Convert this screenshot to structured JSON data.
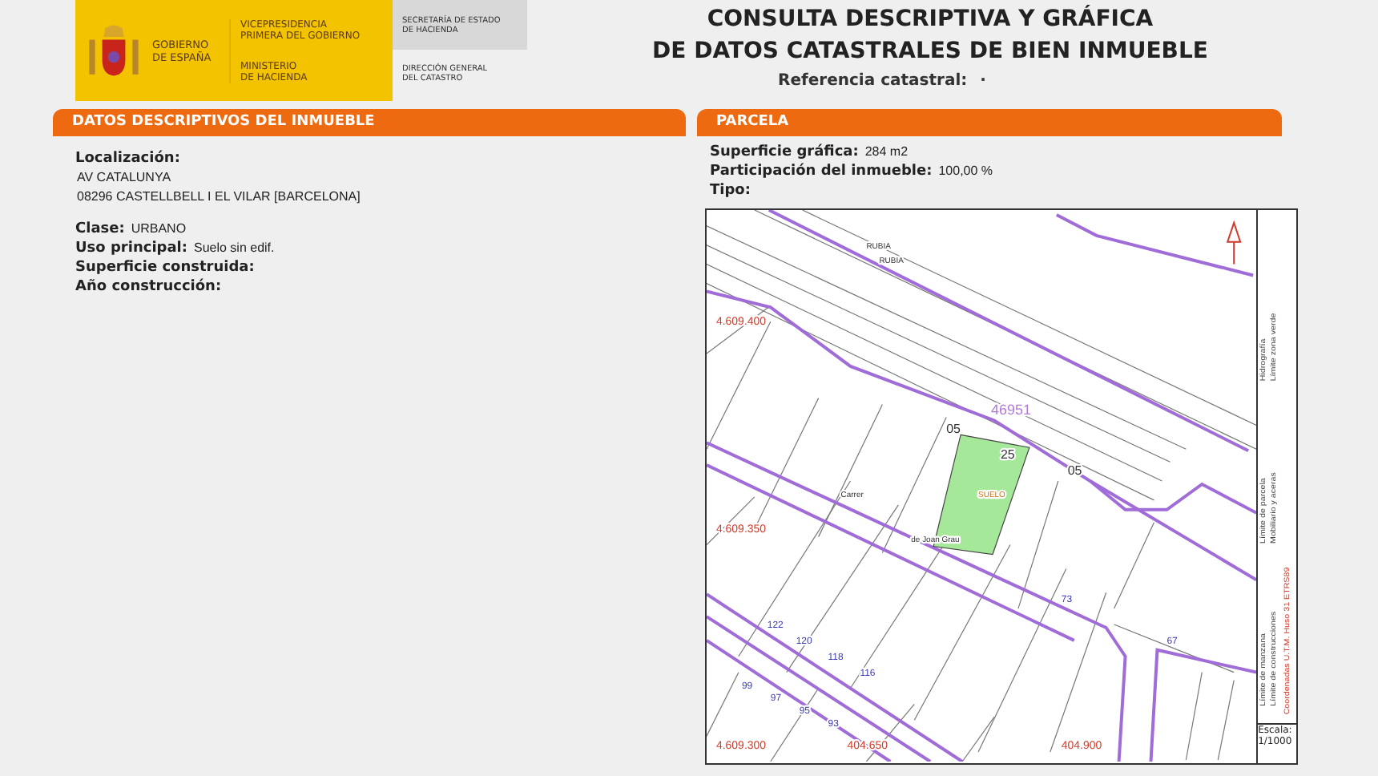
{
  "header": {
    "government": [
      "GOBIERNO",
      "DE ESPAÑA"
    ],
    "vicepresidency": [
      "VICEPRESIDENCIA",
      "PRIMERA DEL GOBIERNO"
    ],
    "ministry": [
      "MINISTERIO",
      "DE HACIENDA"
    ],
    "secretariat": [
      "SECRETARÍA DE ESTADO",
      "DE HACIENDA"
    ],
    "directorate": [
      "DIRECCIÓN GENERAL",
      "DEL CATASTRO"
    ]
  },
  "title": [
    "CONSULTA DESCRIPTIVA Y GRÁFICA",
    "DE DATOS CATASTRALES DE BIEN INMUEBLE"
  ],
  "reference": {
    "label": "Referencia catastral:",
    "value": "·"
  },
  "descriptive": {
    "heading": "DATOS DESCRIPTIVOS DEL INMUEBLE",
    "location_label": "Localización:",
    "address": [
      "AV CATALUNYA",
      "08296 CASTELLBELL I EL VILAR [BARCELONA]"
    ],
    "fields": [
      {
        "label": "Clase:",
        "value": "URBANO"
      },
      {
        "label": "Uso principal:",
        "value": "Suelo sin edif."
      },
      {
        "label": "Superficie construida:"
      },
      {
        "label": "Año construcción:"
      }
    ]
  },
  "parcel": {
    "heading": "PARCELA",
    "fields": [
      {
        "label": "Superficie gráfica:",
        "value": "284 m2"
      },
      {
        "label": "Participación del inmueble:",
        "value": "100,00 %"
      },
      {
        "label": "Tipo:"
      }
    ],
    "map": {
      "labels": [
        {
          "text": "RUBIA",
          "kind": "street"
        },
        {
          "text": "RUBIA",
          "kind": "street"
        },
        {
          "text": "4.609.400",
          "kind": "coordinate"
        },
        {
          "text": "4.609.350",
          "kind": "coordinate"
        },
        {
          "text": "4.609.300",
          "kind": "coordinate"
        },
        {
          "text": "404.650",
          "kind": "coordinate"
        },
        {
          "text": "404.900",
          "kind": "coordinate"
        },
        {
          "text": "46951",
          "kind": "block"
        },
        {
          "text": "05",
          "kind": "parcel"
        },
        {
          "text": "25",
          "kind": "parcel"
        },
        {
          "text": "05",
          "kind": "parcel"
        },
        {
          "text": "SUELO",
          "kind": "use"
        },
        {
          "text": "Carrer",
          "kind": "street"
        },
        {
          "text": "de Joan Grau",
          "kind": "street"
        },
        {
          "text": "73",
          "kind": "number"
        },
        {
          "text": "67",
          "kind": "number"
        },
        {
          "text": "122",
          "kind": "number"
        },
        {
          "text": "120",
          "kind": "number"
        },
        {
          "text": "118",
          "kind": "number"
        },
        {
          "text": "116",
          "kind": "number"
        },
        {
          "text": "99",
          "kind": "number"
        },
        {
          "text": "97",
          "kind": "number"
        },
        {
          "text": "95",
          "kind": "number"
        },
        {
          "text": "93",
          "kind": "number"
        }
      ],
      "legend": [
        "Límite de manzana",
        "Límite de parcela",
        "Hidrografía",
        "Límite de construcciones",
        "Mobiliario y aceras",
        "Límite zona verde"
      ],
      "note": "Coordenadas U.T.M. Huso 31 ETRS89",
      "scale_label": "Escala:",
      "scale": "1/1000"
    }
  }
}
